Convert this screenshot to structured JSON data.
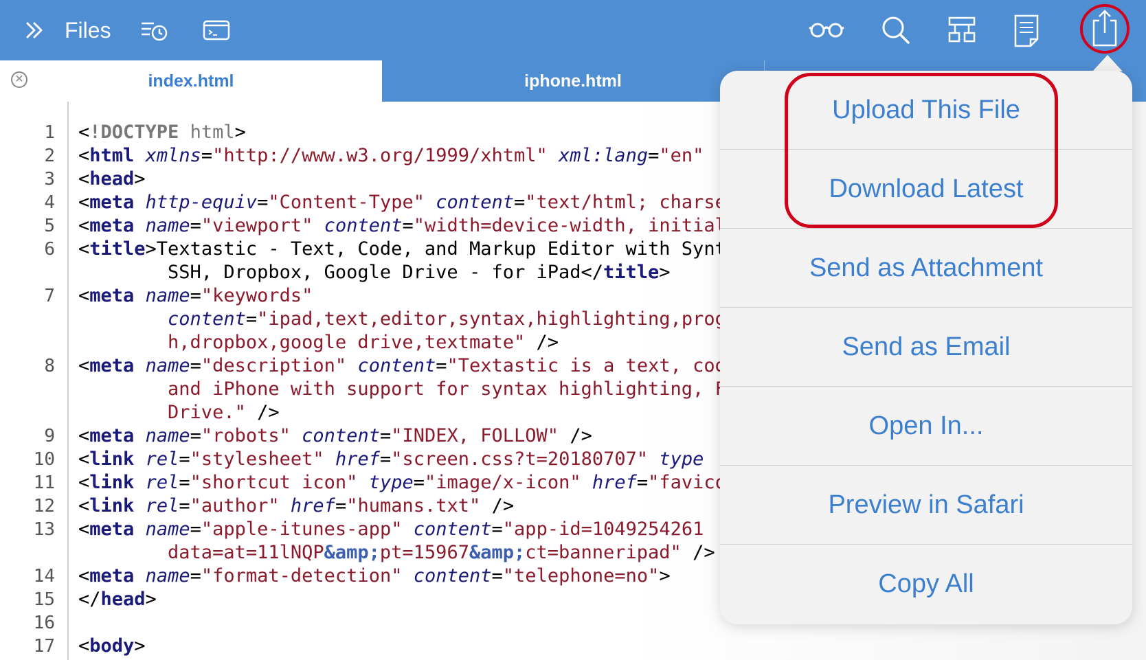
{
  "toolbar": {
    "files_label": "Files"
  },
  "tabs": [
    {
      "label": "index.html"
    },
    {
      "label": "iphone.html"
    }
  ],
  "editor": {
    "line_numbers": [
      "1",
      "2",
      "3",
      "4",
      "5",
      "6",
      "7",
      "8",
      "9",
      "10",
      "11",
      "12",
      "13",
      "14",
      "15",
      "16",
      "17"
    ]
  },
  "share_menu": {
    "items": [
      {
        "label": "Upload This File"
      },
      {
        "label": "Download Latest"
      },
      {
        "label": "Send as Attachment"
      },
      {
        "label": "Send as Email"
      },
      {
        "label": "Open In..."
      },
      {
        "label": "Preview in Safari"
      },
      {
        "label": "Copy All"
      }
    ]
  },
  "colors": {
    "toolbar_bg": "#4f8ed3",
    "accent": "#3d7fcf",
    "highlight": "#d0021b"
  }
}
